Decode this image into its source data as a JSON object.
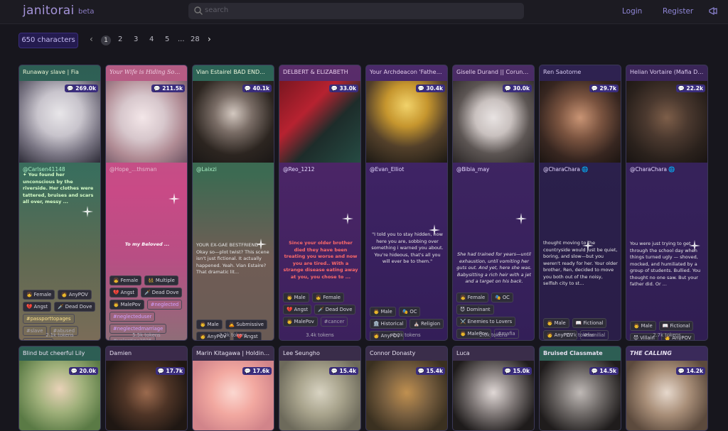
{
  "header": {
    "logo": "janitorai",
    "beta": "beta",
    "search_placeholder": "search",
    "login": "Login",
    "register": "Register"
  },
  "pager": {
    "count": "650 characters",
    "pages": [
      "1",
      "2",
      "3",
      "4",
      "5",
      "...",
      "28"
    ]
  },
  "colors": {
    "accent": "#8f86d6",
    "badge": "#3a2d7d",
    "chip": "#241b4f"
  },
  "cards": [
    {
      "title": "Runaway slave | Fia",
      "badge": "269.0k",
      "creator": "@Carlsen41148",
      "desc": "✦ You found her unconscious by the riverside. Her clothes were tattered, bruises and scars all over, messy ...",
      "tags": [
        "👧 Female",
        "🧑 AnyPOV",
        "💔 Angst",
        "🗡️ Dead Dove",
        "#passporttopages",
        "#slave",
        "#abused",
        "#tortured"
      ],
      "tokens": "2.1k tokens"
    },
    {
      "title": "Your Wife is Hiding Somet...",
      "badge": "211.5k",
      "creator": "@Hope_…thsman",
      "desc": "To my Beloved ...",
      "tags": [
        "👧 Female",
        "👯 Multiple",
        "💔 Angst",
        "🗡️ Dead Dove",
        "👨 MalePov",
        "#neglected",
        "#neglecteduser",
        "#neglectedmarriage",
        "#valentine2025",
        "#musicmania2"
      ],
      "tokens": "5.5k tokens"
    },
    {
      "title": "Vian Estairel BAD END...",
      "badge": "40.1k",
      "creator": "@Laixzi",
      "desc": "YOUR EX-GAE BESTFRIEND Okay so—plot twist? This scene isn't just fictional. It actually happened. Yeah. Vian Estaire? That dramatic lit...",
      "tags": [
        "👨 Male",
        "🙇 Submissive",
        "🧑 AnyPOV",
        "💔 Angst",
        "#musicmania2",
        "#passporttopages",
        "#menwhowhimper",
        "#friendstostrangers",
        "#campus",
        "#fembot"
      ],
      "tokens": "3.2k tokens"
    },
    {
      "title": "DELBERT & ELIZABETH",
      "badge": "33.0k",
      "creator": "@Reo_1212",
      "desc": "Since your older brother died they have been treating you worse and now you are tired.. With a strange disease eating away at you, you chose to ...",
      "tags": [
        "👨 Male",
        "👧 Female",
        "💔 Angst",
        "🗡️ Dead Dove",
        "👨 MalePov",
        "#cancer"
      ],
      "tokens": "3.4k tokens"
    },
    {
      "title": "Your Archdeacon 'Father'...",
      "badge": "30.4k",
      "creator": "@Evan_Elliot",
      "desc": "\"I told you to stay hidden, now here you are, sobbing over something i warned you about. You're hideous, that's all you will ever be to them.\"",
      "tags": [
        "👨 Male",
        "🎭 OC",
        "🏛️ Historical",
        "⛪ Religion",
        "🧑 AnyPOV",
        "🗡️ Dead Dove",
        "#platonic",
        "#fatherchar",
        "#priest"
      ],
      "tokens": "2.1k tokens"
    },
    {
      "title": "Giselle Durand || Corund...",
      "badge": "30.0k",
      "creator": "@Bibia_may",
      "desc": "She had trained for years—until exhaustion, until vomiting her guts out. And yet, here she was. Babysitting a rich heir with a jet and a target on his back.",
      "tags": [
        "👧 Female",
        "🎭 OC",
        "😈 Dominant",
        "⚔️ Enemies to Lovers",
        "👨 MalePov",
        "#mafia",
        "#corundummafia",
        "#bodyguard"
      ],
      "tokens": "2.0k tokens"
    },
    {
      "title": "Ren Saotome",
      "badge": "29.7k",
      "creator": "@CharaChara 🌐",
      "desc": "thought moving to the countryside would just be quiet, boring, and slow—but you weren't ready for her. Your older brother, Ren, decided to move you both out of the noisy, selfish city to st...",
      "tags": [
        "👨 Male",
        "📖 Fictional",
        "🧑 AnyPOV",
        "#familial",
        "#brother",
        "#olderbrother",
        "#platonic"
      ],
      "tokens": "2.7k tokens"
    },
    {
      "title": "Helian Vortaire (Mafia Dad)",
      "badge": "22.2k",
      "creator": "@CharaChara 🌐",
      "desc": "You were just trying to get through the school day when things turned ugly — shoved, mocked, and humiliated by a group of students. Bullied. You thought no one saw. But your father did. Or ...",
      "tags": [
        "👨 Male",
        "📖 Fictional",
        "😈 Villain",
        "🧑 AnyPOV",
        "❤️ Fluff",
        "#mafiadad",
        "#platonic",
        "#father",
        "#familial"
      ],
      "tokens": "2.7k tokens"
    }
  ],
  "cards2": [
    {
      "title": "Blind but cheerful Lily",
      "badge": "20.0k"
    },
    {
      "title": "Damien",
      "badge": "17.7k"
    },
    {
      "title": "Marin Kitagawa | Holding ...",
      "badge": "17.6k"
    },
    {
      "title": "Lee Seungho",
      "badge": "15.4k"
    },
    {
      "title": "Connor Donasty",
      "badge": "15.4k"
    },
    {
      "title": "Luca",
      "badge": "15.0k"
    },
    {
      "title": "Bruised Classmate",
      "badge": "14.5k"
    },
    {
      "title": "THE CALLING",
      "badge": "14.2k"
    }
  ]
}
